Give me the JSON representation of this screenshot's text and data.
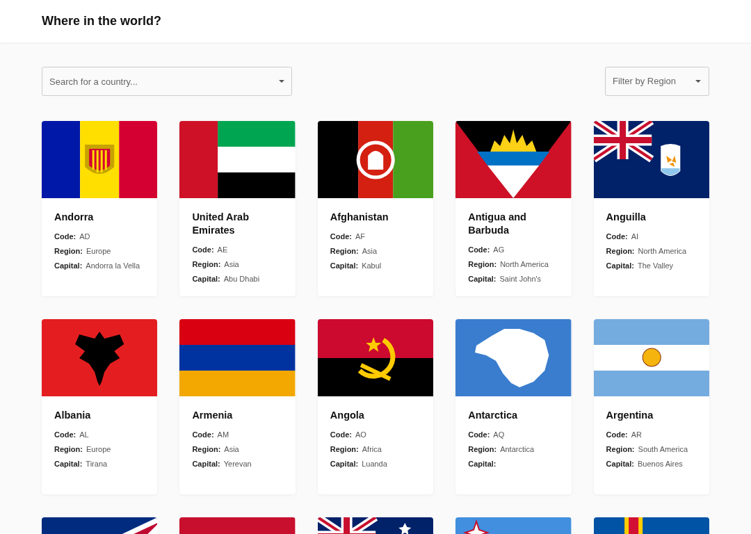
{
  "header": {
    "title": "Where in the world?"
  },
  "search": {
    "placeholder": "Search for a country..."
  },
  "filter": {
    "placeholder": "Filter by Region"
  },
  "countries": [
    {
      "name": "Andorra",
      "fields": [
        {
          "label": "Code:",
          "value": "AD"
        },
        {
          "label": "Region:",
          "value": "Europe"
        },
        {
          "label": "Capital:",
          "value": "Andorra la Vella"
        }
      ]
    },
    {
      "name": "United Arab Emirates",
      "fields": [
        {
          "label": "Code:",
          "value": "AE"
        },
        {
          "label": "Region:",
          "value": "Asia"
        },
        {
          "label": "Capital:",
          "value": "Abu Dhabi"
        }
      ]
    },
    {
      "name": "Afghanistan",
      "fields": [
        {
          "label": "Code:",
          "value": "AF"
        },
        {
          "label": "Region:",
          "value": "Asia"
        },
        {
          "label": "Capital:",
          "value": "Kabul"
        }
      ]
    },
    {
      "name": "Antigua and Barbuda",
      "fields": [
        {
          "label": "Code:",
          "value": "AG"
        },
        {
          "label": "Region:",
          "value": "North America"
        },
        {
          "label": "Capital:",
          "value": "Saint John's"
        }
      ]
    },
    {
      "name": "Anguilla",
      "fields": [
        {
          "label": "Code:",
          "value": "AI"
        },
        {
          "label": "Region:",
          "value": "North America"
        },
        {
          "label": "Capital:",
          "value": "The Valley"
        }
      ]
    },
    {
      "name": "Albania",
      "fields": [
        {
          "label": "Code:",
          "value": "AL"
        },
        {
          "label": "Region:",
          "value": "Europe"
        },
        {
          "label": "Capital:",
          "value": "Tirana"
        }
      ]
    },
    {
      "name": "Armenia",
      "fields": [
        {
          "label": "Code:",
          "value": "AM"
        },
        {
          "label": "Region:",
          "value": "Asia"
        },
        {
          "label": "Capital:",
          "value": "Yerevan"
        }
      ]
    },
    {
      "name": "Angola",
      "fields": [
        {
          "label": "Code:",
          "value": "AO"
        },
        {
          "label": "Region:",
          "value": "Africa"
        },
        {
          "label": "Capital:",
          "value": "Luanda"
        }
      ]
    },
    {
      "name": "Antarctica",
      "fields": [
        {
          "label": "Code:",
          "value": "AQ"
        },
        {
          "label": "Region:",
          "value": "Antarctica"
        },
        {
          "label": "Capital:"
        }
      ]
    },
    {
      "name": "Argentina",
      "fields": [
        {
          "label": "Code:",
          "value": "AR"
        },
        {
          "label": "Region:",
          "value": "South America"
        },
        {
          "label": "Capital:",
          "value": "Buenos Aires"
        }
      ]
    }
  ]
}
